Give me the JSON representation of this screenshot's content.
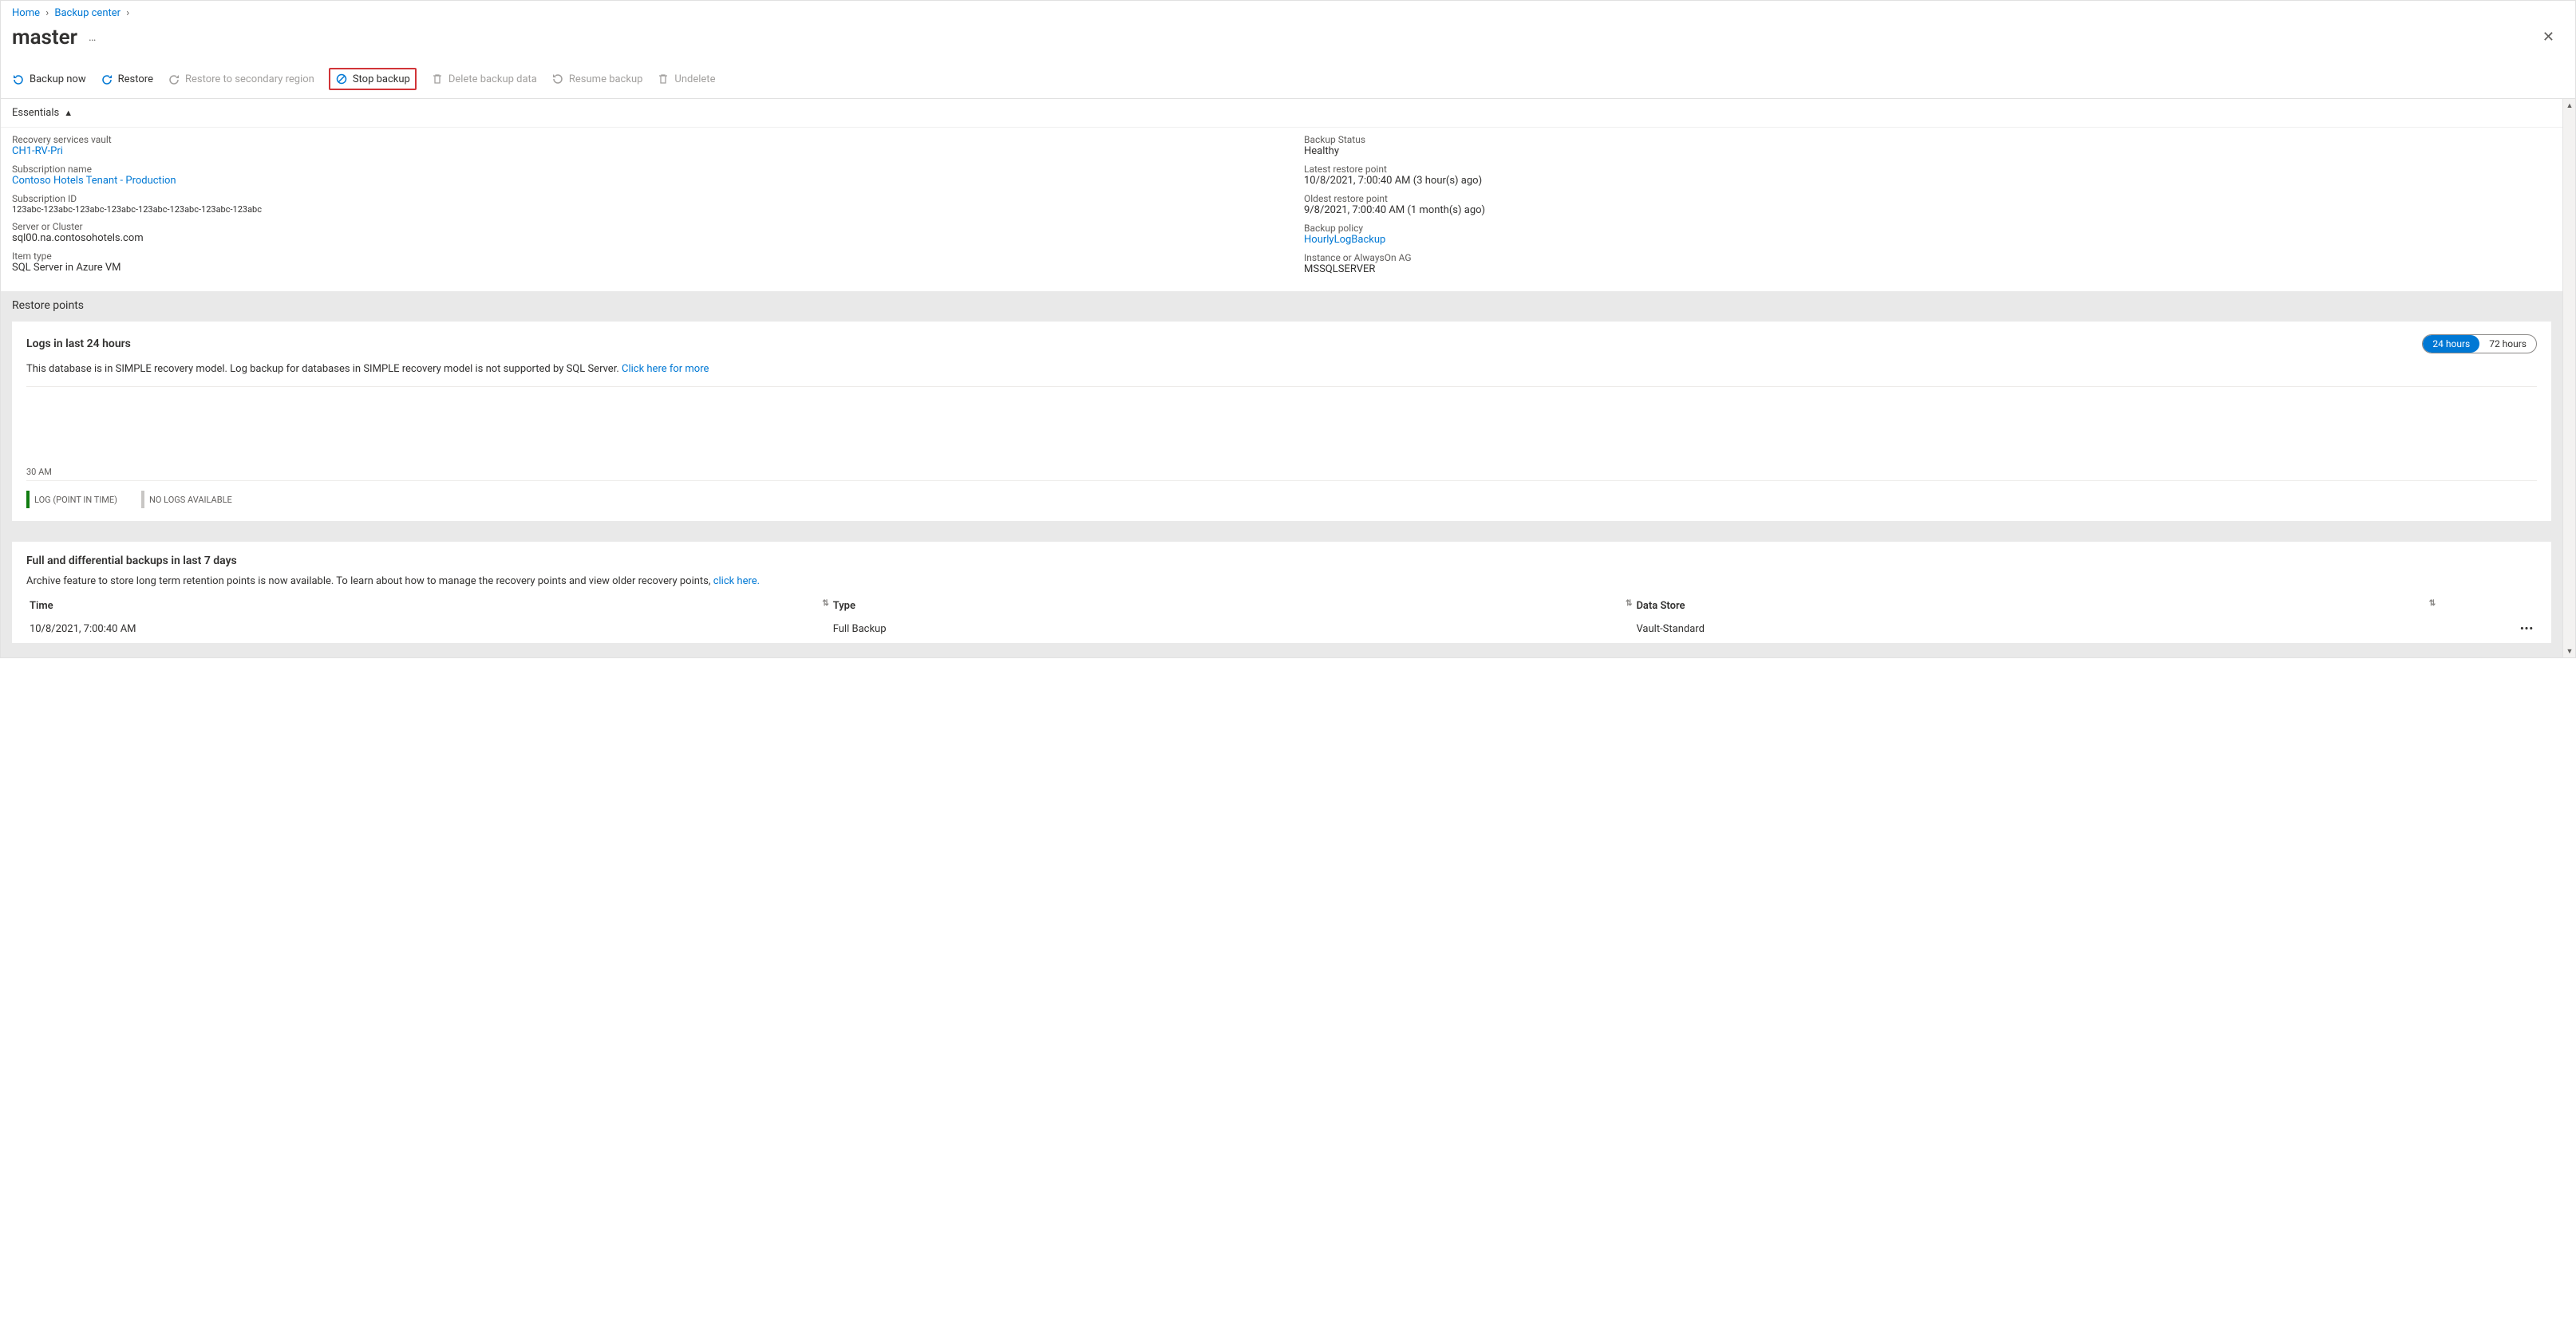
{
  "breadcrumb": {
    "home": "Home",
    "backup_center": "Backup center"
  },
  "title": "master",
  "toolbar": {
    "backup_now": "Backup now",
    "restore": "Restore",
    "restore_secondary": "Restore to secondary region",
    "stop_backup": "Stop backup",
    "delete_backup": "Delete backup data",
    "resume_backup": "Resume backup",
    "undelete": "Undelete"
  },
  "essentials": {
    "header": "Essentials",
    "left": {
      "vault_label": "Recovery services vault",
      "vault_value": "CH1-RV-Pri",
      "sub_name_label": "Subscription name",
      "sub_name_value": "Contoso Hotels Tenant - Production",
      "sub_id_label": "Subscription ID",
      "sub_id_value": "123abc-123abc-123abc-123abc-123abc-123abc-123abc-123abc",
      "server_label": "Server or Cluster",
      "server_value": "sql00.na.contosohotels.com",
      "item_type_label": "Item type",
      "item_type_value": "SQL Server in Azure VM"
    },
    "right": {
      "status_label": "Backup Status",
      "status_value": "Healthy",
      "latest_label": "Latest restore point",
      "latest_value": "10/8/2021, 7:00:40 AM (3 hour(s) ago)",
      "oldest_label": "Oldest restore point",
      "oldest_value": "9/8/2021, 7:00:40 AM (1 month(s) ago)",
      "policy_label": "Backup policy",
      "policy_value": "HourlyLogBackup",
      "instance_label": "Instance or AlwaysOn AG",
      "instance_value": "MSSQLSERVER"
    }
  },
  "restore_points_title": "Restore points",
  "logs_card": {
    "title": "Logs in last 24 hours",
    "desc_text": "This database is in SIMPLE recovery model. Log backup for databases in SIMPLE recovery model is not supported by SQL Server. ",
    "desc_link": "Click here for more",
    "toggle_24": "24 hours",
    "toggle_72": "72 hours",
    "xlabel": "30 AM",
    "legend_log": "LOG (POINT IN TIME)",
    "legend_nolog": "NO LOGS AVAILABLE"
  },
  "backups_card": {
    "title": "Full and differential backups in last 7 days",
    "desc_text": "Archive feature to store long term retention points is now available. To learn about how to manage the recovery points and view older recovery points, ",
    "desc_link": "click here.",
    "col_time": "Time",
    "col_type": "Type",
    "col_store": "Data Store",
    "row0": {
      "time": "10/8/2021, 7:00:40 AM",
      "type": "Full Backup",
      "store": "Vault-Standard"
    }
  },
  "chart_data": {
    "type": "bar",
    "categories": [
      "30 AM"
    ],
    "series": [
      {
        "name": "LOG (POINT IN TIME)",
        "values": []
      },
      {
        "name": "NO LOGS AVAILABLE",
        "values": []
      }
    ],
    "title": "Logs in last 24 hours",
    "xlabel": "",
    "ylabel": "",
    "ylim": [
      0,
      0
    ]
  }
}
